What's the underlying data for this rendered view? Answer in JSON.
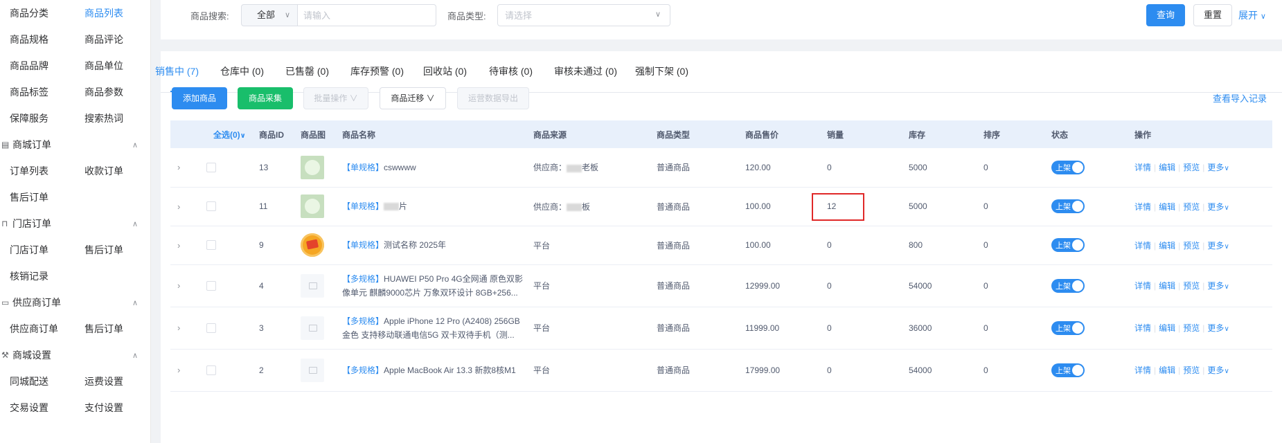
{
  "sidebar": {
    "top_items": [
      {
        "label": "商品分类",
        "active": false
      },
      {
        "label": "商品列表",
        "active": true
      },
      {
        "label": "商品规格",
        "active": false
      },
      {
        "label": "商品评论",
        "active": false
      },
      {
        "label": "商品品牌",
        "active": false
      },
      {
        "label": "商品单位",
        "active": false
      },
      {
        "label": "商品标签",
        "active": false
      },
      {
        "label": "商品参数",
        "active": false
      },
      {
        "label": "保障服务",
        "active": false
      },
      {
        "label": "搜索热词",
        "active": false
      }
    ],
    "groups": [
      {
        "title": "商城订单",
        "icon": "order-icon",
        "items": [
          "订单列表",
          "收款订单",
          "售后订单"
        ]
      },
      {
        "title": "门店订单",
        "icon": "store-icon",
        "items": [
          "门店订单",
          "售后订单",
          "核销记录"
        ]
      },
      {
        "title": "供应商订单",
        "icon": "supplier-icon",
        "items": [
          "供应商订单",
          "售后订单"
        ]
      },
      {
        "title": "商城设置",
        "icon": "wrench-icon",
        "items": [
          "同城配送",
          "运费设置",
          "交易设置",
          "支付设置"
        ]
      }
    ]
  },
  "search": {
    "keyword_label": "商品搜索:",
    "scope_value": "全部",
    "keyword_placeholder": "请输入",
    "type_label": "商品类型:",
    "type_placeholder": "请选择",
    "query_button": "查询",
    "reset_button": "重置",
    "expand_link": "展开"
  },
  "tabs": [
    {
      "label": "销售中 (7)",
      "active": true
    },
    {
      "label": "仓库中 (0)",
      "active": false
    },
    {
      "label": "已售罄 (0)",
      "active": false
    },
    {
      "label": "库存预警 (0)",
      "active": false
    },
    {
      "label": "回收站 (0)",
      "active": false
    },
    {
      "label": "待审核 (0)",
      "active": false
    },
    {
      "label": "审核未通过 (0)",
      "active": false
    },
    {
      "label": "强制下架 (0)",
      "active": false
    }
  ],
  "actions": {
    "add_goods": "添加商品",
    "collect_goods": "商品采集",
    "batch_ops": "批量操作",
    "migrate": "商品迁移",
    "export": "运营数据导出",
    "import_records": "查看导入记录"
  },
  "table": {
    "headers": {
      "select_all": "全选(0)",
      "id": "商品ID",
      "image": "商品图",
      "name": "商品名称",
      "source": "商品来源",
      "type": "商品类型",
      "price": "商品售价",
      "sales": "销量",
      "stock": "库存",
      "sort": "排序",
      "status": "状态",
      "ops": "操作"
    },
    "rows": [
      {
        "id": "13",
        "thumb": "cart",
        "tag": "【单规格】",
        "name": "cswwww",
        "source_prefix": "供应商：",
        "source_suffix": "老板",
        "source_masked": true,
        "type": "普通商品",
        "price": "120.00",
        "sales": "0",
        "stock": "5000",
        "sort": "0",
        "status": "上架",
        "h": "h56"
      },
      {
        "id": "11",
        "thumb": "cart",
        "tag": "【单规格】",
        "name": "片",
        "source_prefix": "供应商：",
        "source_suffix": "板",
        "source_masked": true,
        "type": "普通商品",
        "price": "100.00",
        "sales": "12",
        "stock": "5000",
        "sort": "0",
        "status": "上架",
        "h": "h56",
        "highlight": true
      },
      {
        "id": "9",
        "thumb": "orange",
        "tag": "【单规格】",
        "name": "测试名称 2025年",
        "source_prefix": "平台",
        "source_suffix": "",
        "source_masked": false,
        "type": "普通商品",
        "price": "100.00",
        "sales": "0",
        "stock": "800",
        "sort": "0",
        "status": "上架",
        "h": "h56"
      },
      {
        "id": "4",
        "thumb": "placeholder",
        "tag": "【多规格】",
        "name": "HUAWEI P50 Pro 4G全网通 原色双影像单元 麒麟9000芯片 万象双环设计 8GB+256...",
        "source_prefix": "平台",
        "source_suffix": "",
        "source_masked": false,
        "type": "普通商品",
        "price": "12999.00",
        "sales": "0",
        "stock": "54000",
        "sort": "0",
        "status": "上架",
        "h": "h61"
      },
      {
        "id": "3",
        "thumb": "placeholder",
        "tag": "【多规格】",
        "name": "Apple iPhone 12 Pro (A2408) 256GB 金色 支持移动联通电信5G 双卡双待手机（测...",
        "source_prefix": "平台",
        "source_suffix": "",
        "source_masked": false,
        "type": "普通商品",
        "price": "11999.00",
        "sales": "0",
        "stock": "36000",
        "sort": "0",
        "status": "上架",
        "h": "h61"
      },
      {
        "id": "2",
        "thumb": "placeholder",
        "tag": "【多规格】",
        "name": "Apple MacBook Air 13.3 新款8核M1",
        "source_prefix": "平台",
        "source_suffix": "",
        "source_masked": false,
        "type": "普通商品",
        "price": "17999.00",
        "sales": "0",
        "stock": "54000",
        "sort": "0",
        "status": "上架",
        "h": "h61"
      }
    ],
    "row_actions": [
      "详情",
      "编辑",
      "预览",
      "更多"
    ]
  }
}
